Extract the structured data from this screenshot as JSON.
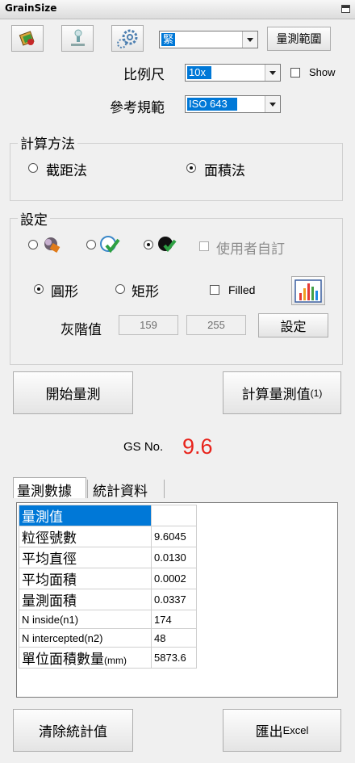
{
  "window": {
    "title": "GrainSize"
  },
  "toolbar": {
    "combo_value": "緊",
    "measure_range_label": "量測範圍"
  },
  "scale": {
    "label": "比例尺",
    "value": "10x",
    "show_label": "Show"
  },
  "standard": {
    "label": "參考規範",
    "value": "ISO 643"
  },
  "method": {
    "legend": "計算方法",
    "options": [
      "截距法",
      "面積法"
    ],
    "selected": "面積法"
  },
  "settings": {
    "legend": "設定",
    "user_custom_label": "使用者自訂",
    "shapes": [
      "圓形",
      "矩形"
    ],
    "filled_label": "Filled",
    "gray_label": "灰階值",
    "gray_min": "159",
    "gray_max": "255",
    "set_button": "設定"
  },
  "actions": {
    "start": "開始量測",
    "calc": "計算量測值",
    "calc_count": "(1)"
  },
  "result": {
    "gs_label": "GS No.",
    "gs_value": "9.6"
  },
  "tabs": [
    "量測數據",
    "統計資料"
  ],
  "table": [
    {
      "key": "量測值",
      "key_suffix": "",
      "value": ""
    },
    {
      "key": "粒徑號數",
      "key_suffix": "",
      "value": "9.6045"
    },
    {
      "key": "平均直徑",
      "key_suffix": "",
      "value": "0.0130"
    },
    {
      "key": "平均面積",
      "key_suffix": "",
      "value": "0.0002"
    },
    {
      "key": "量測面積",
      "key_suffix": "",
      "value": "0.0337"
    },
    {
      "key": "N inside(n1)",
      "key_suffix": "",
      "value": "174"
    },
    {
      "key": "N intercepted(n2)",
      "key_suffix": "",
      "value": "48"
    },
    {
      "key": "單位面積數量",
      "key_suffix": "(mm)",
      "value": "5873.6"
    }
  ],
  "bottom": {
    "clear": "清除統計值",
    "export": "匯出",
    "export_suffix": "Excel"
  },
  "colors": {
    "accent": "#0078d7",
    "gs_value": "#e8231b"
  }
}
